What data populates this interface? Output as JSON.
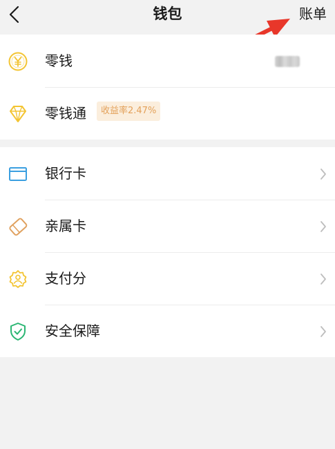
{
  "nav": {
    "title": "钱包",
    "bill_label": "账单"
  },
  "wallet": {
    "items": [
      {
        "label": "零钱",
        "icon": "yuan-coin-icon"
      },
      {
        "label": "零钱通",
        "icon": "diamond-icon",
        "badge": "收益率2.47%"
      }
    ]
  },
  "cards": {
    "items": [
      {
        "label": "银行卡",
        "icon": "bank-card-icon"
      },
      {
        "label": "亲属卡",
        "icon": "family-card-icon"
      },
      {
        "label": "支付分",
        "icon": "pay-score-icon"
      },
      {
        "label": "安全保障",
        "icon": "shield-check-icon"
      }
    ]
  },
  "colors": {
    "background": "#f2f2f2",
    "arrow": "#e8372a",
    "coin": "#f3c432",
    "diamond": "#f3c432",
    "bank_card": "#3a9fe0",
    "family_card": "#e0a15f",
    "pay_score": "#f3c432",
    "shield": "#2bb673",
    "badge_bg": "#fbeedd",
    "badge_text": "#e3a15a"
  }
}
